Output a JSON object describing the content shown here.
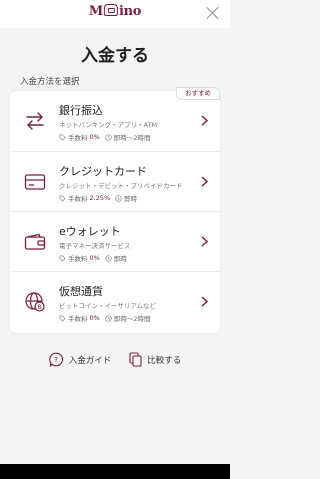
{
  "header": {
    "logo_text_left": "M",
    "logo_text_right": "ino"
  },
  "page_title": "入金する",
  "section_label": "入金方法を選択",
  "recommend_badge": "おすすめ",
  "methods": [
    {
      "name": "銀行振込",
      "sub": "ネットバンキング・アプリ・ATM",
      "fee_label": "手数料",
      "fee_value": "0%",
      "time": "即時〜2時間",
      "icon": "bank-transfer-arrows-icon"
    },
    {
      "name": "クレジットカード",
      "sub": "クレジット・デビット・プリペイドカード",
      "fee_label": "手数料",
      "fee_value": "2.25%",
      "time": "即時",
      "icon": "credit-card-icon"
    },
    {
      "name": "eウォレット",
      "sub": "電子マネー決済サービス",
      "fee_label": "手数料",
      "fee_value": "0%",
      "time": "即時",
      "icon": "wallet-icon"
    },
    {
      "name": "仮想通貨",
      "sub": "ビットコイン・イーサリアムなど",
      "fee_label": "手数料",
      "fee_value": "0%",
      "time": "即時〜2時間",
      "icon": "crypto-globe-icon"
    }
  ],
  "footer": {
    "guide_label": "入金ガイド",
    "compare_label": "比較する"
  },
  "colors": {
    "accent": "#7a2043",
    "background": "#f4f4f4"
  }
}
